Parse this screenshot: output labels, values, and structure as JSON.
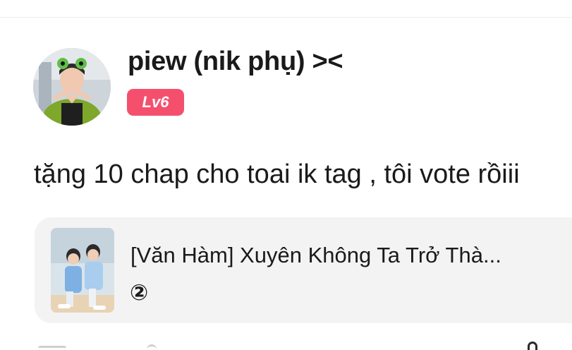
{
  "comment": {
    "user": {
      "name": "piew (nik phụ) ><",
      "level": "Lv6",
      "avatar_icon": "user-avatar-photo"
    },
    "text": "tặng 10 chap cho toai ik tag , tôi vote rồiii",
    "linked_story": {
      "title": "[Văn Hàm] Xuyên Không Ta Trở Thà...",
      "count": "②",
      "thumbnail_icon": "story-cover-image"
    }
  },
  "colors": {
    "level_badge": "#f4506e",
    "card_background": "#f3f3f3",
    "text_primary": "#1a1a1a"
  }
}
